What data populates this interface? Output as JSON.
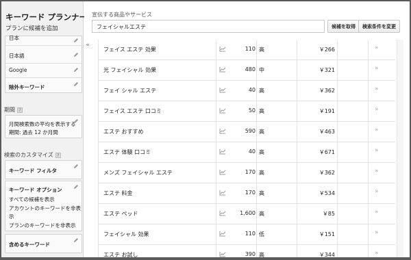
{
  "sidebar": {
    "app_title": "キーワード プランナー",
    "app_subtitle": "プランに候補を追加",
    "targeting": {
      "partial_top": "日本",
      "language": "日本語",
      "network": "Google",
      "negative_keywords": "除外キーワード"
    },
    "period": {
      "heading": "期間",
      "line1": "月間検索数の平均を表示する",
      "line2": "期間: 過去 12 か月間"
    },
    "customize": {
      "heading": "検索のカスタマイズ",
      "keyword_filter": "キーワード フィルタ",
      "keyword_options": "キーワード オプション",
      "opt1": "すべての候補を表示",
      "opt2a": "アカウントのキーワードを非表",
      "opt2b": "示",
      "opt3": "プランのキーワードを非表示",
      "include_keywords": "含めるキーワード"
    },
    "collapse_glyph": "«"
  },
  "header": {
    "label": "宣伝する商品やサービス",
    "input_value": "フェイシャルエステ",
    "get_ideas_button": "候補を取得",
    "modify_search_button": "検索条件を変更"
  },
  "table": {
    "add_glyph": "»",
    "rows": [
      {
        "keyword": "フェイス エステ 効果",
        "volume": "110",
        "competition": "高",
        "bid": "￥266"
      },
      {
        "keyword": "光 フェイシャル 効果",
        "volume": "480",
        "competition": "中",
        "bid": "￥321"
      },
      {
        "keyword": "フェイ シャル エステ",
        "volume": "40",
        "competition": "高",
        "bid": "￥362"
      },
      {
        "keyword": "フェイス エステ 口コミ",
        "volume": "50",
        "competition": "高",
        "bid": "￥191"
      },
      {
        "keyword": "エステ おすすめ",
        "volume": "590",
        "competition": "高",
        "bid": "￥463"
      },
      {
        "keyword": "エステ 体験 口コミ",
        "volume": "40",
        "competition": "高",
        "bid": "￥671"
      },
      {
        "keyword": "メンズ フェイシャル エステ",
        "volume": "170",
        "competition": "高",
        "bid": "￥362"
      },
      {
        "keyword": "エステ 料金",
        "volume": "170",
        "competition": "高",
        "bid": "￥534"
      },
      {
        "keyword": "エステ ペッド",
        "volume": "1,600",
        "competition": "高",
        "bid": "￥85"
      },
      {
        "keyword": "フェイシャル 効果",
        "volume": "110",
        "competition": "低",
        "bid": "￥151"
      },
      {
        "keyword": "エステ お試し",
        "volume": "390",
        "competition": "高",
        "bid": "￥344"
      }
    ]
  },
  "colors": {
    "sidebar_bg": "#f1f1f1",
    "frame_border": "#5a5a5a",
    "row_divider": "#e1e1e1"
  },
  "icons": [
    "pencil-icon",
    "trend-chart-icon",
    "help-icon",
    "collapse-icon",
    "add-arrow-icon"
  ]
}
